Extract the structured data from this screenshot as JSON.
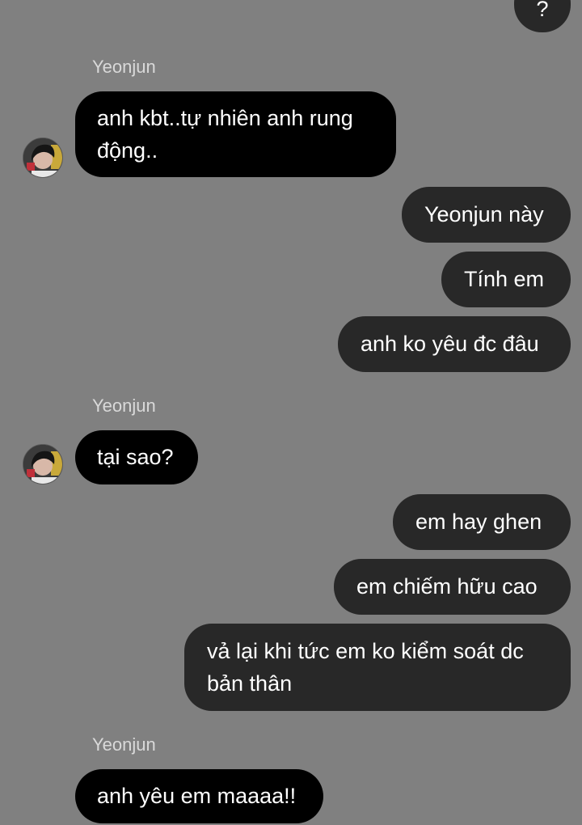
{
  "conversation": {
    "messages": [
      {
        "direction": "outgoing",
        "text": "?"
      },
      {
        "direction": "incoming",
        "sender": "Yeonjun",
        "text": "anh kbt..tự nhiên anh rung động.."
      },
      {
        "direction": "outgoing",
        "text": "Yeonjun này"
      },
      {
        "direction": "outgoing",
        "text": "Tính em"
      },
      {
        "direction": "outgoing",
        "text": "anh ko yêu đc đâu"
      },
      {
        "direction": "incoming",
        "sender": "Yeonjun",
        "text": "tại sao?"
      },
      {
        "direction": "outgoing",
        "text": "em hay ghen"
      },
      {
        "direction": "outgoing",
        "text": "em chiếm hữu cao"
      },
      {
        "direction": "outgoing",
        "text": "vả lại khi tức em ko kiểm soát dc bản thân"
      },
      {
        "direction": "incoming",
        "sender": "Yeonjun",
        "text": "anh yêu em maaaa!!"
      }
    ]
  },
  "colors": {
    "background": "#808080",
    "incoming_bubble": "#000000",
    "outgoing_bubble": "#282828",
    "text": "#ffffff",
    "sender_name": "#d9d9d9"
  }
}
